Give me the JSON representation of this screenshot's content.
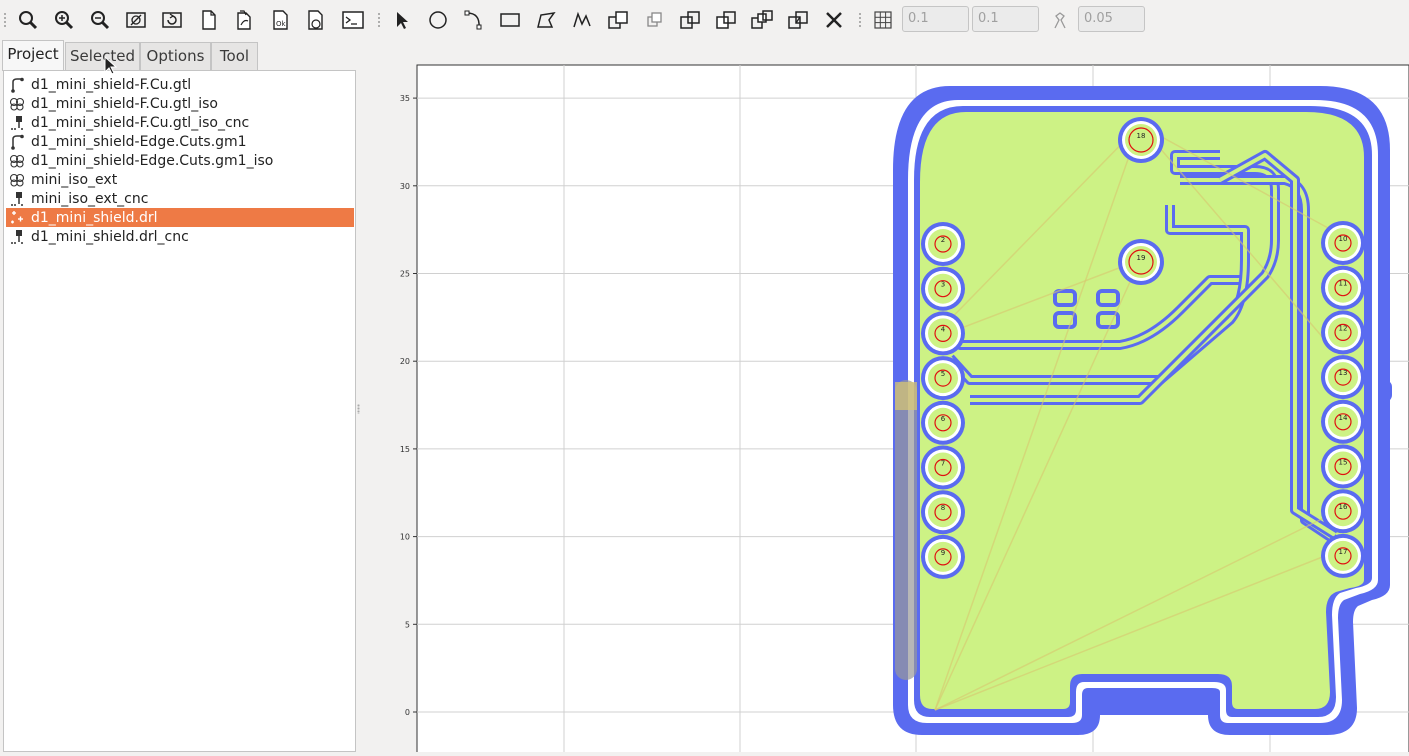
{
  "toolbar": {
    "tools": [
      {
        "name": "zoom-fit-icon"
      },
      {
        "name": "zoom-in-icon"
      },
      {
        "name": "zoom-out-icon"
      },
      {
        "name": "clear-plot-icon"
      },
      {
        "name": "replot-icon"
      },
      {
        "name": "new-project-icon"
      },
      {
        "name": "open-gerber-icon"
      },
      {
        "name": "open-excellon-icon"
      },
      {
        "name": "open-gcode-icon"
      },
      {
        "name": "shell-icon"
      },
      {
        "name": "select-icon"
      },
      {
        "name": "circle-icon"
      },
      {
        "name": "arc-icon"
      },
      {
        "name": "rectangle-icon"
      },
      {
        "name": "polygon-icon"
      },
      {
        "name": "path-icon"
      },
      {
        "name": "move-icon"
      },
      {
        "name": "copy-icon"
      },
      {
        "name": "union-icon"
      },
      {
        "name": "intersection-icon"
      },
      {
        "name": "subtract-icon"
      },
      {
        "name": "cut-icon"
      },
      {
        "name": "delete-icon"
      },
      {
        "name": "grid-snap-icon"
      },
      {
        "name": "corner-snap-icon"
      }
    ],
    "grid_x": "0.1",
    "grid_y": "0.1",
    "snap_max": "0.05"
  },
  "tabs": [
    "Project",
    "Selected",
    "Options",
    "Tool"
  ],
  "project_items": [
    {
      "label": "d1_mini_shield-F.Cu.gtl",
      "icon": "gerber-icon"
    },
    {
      "label": "d1_mini_shield-F.Cu.gtl_iso",
      "icon": "geometry-icon"
    },
    {
      "label": "d1_mini_shield-F.Cu.gtl_iso_cnc",
      "icon": "cnc-icon"
    },
    {
      "label": "d1_mini_shield-Edge.Cuts.gm1",
      "icon": "gerber-icon"
    },
    {
      "label": "d1_mini_shield-Edge.Cuts.gm1_iso",
      "icon": "geometry-icon"
    },
    {
      "label": "mini_iso_ext",
      "icon": "geometry-icon"
    },
    {
      "label": "mini_iso_ext_cnc",
      "icon": "cnc-icon"
    },
    {
      "label": "d1_mini_shield.drl",
      "icon": "drill-icon",
      "selected": true
    },
    {
      "label": "d1_mini_shield.drl_cnc",
      "icon": "cnc-icon"
    }
  ],
  "plot": {
    "y_ticks": [
      "35",
      "30",
      "25",
      "20",
      "15",
      "10",
      "5",
      "0"
    ],
    "pads_left": [
      "2",
      "3",
      "4",
      "5",
      "6",
      "7",
      "8",
      "9"
    ],
    "pads_right": [
      "10",
      "11",
      "12",
      "13",
      "14",
      "15",
      "16",
      "17"
    ],
    "pads_top": [
      "18",
      "19"
    ],
    "colors": {
      "board": "#cdf285",
      "isolation": "#5a6bf0",
      "drill": "#e01010",
      "trace": "#d8c870"
    }
  }
}
